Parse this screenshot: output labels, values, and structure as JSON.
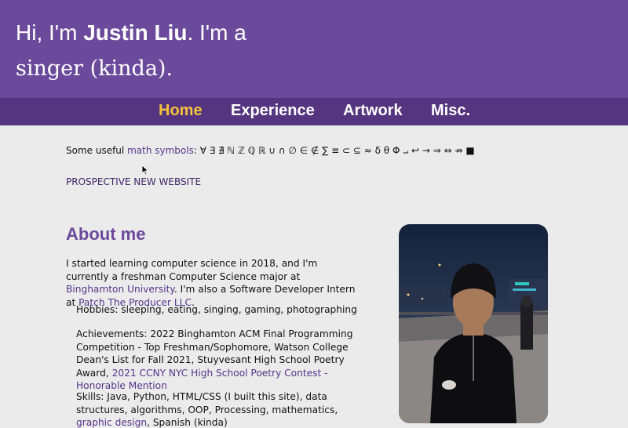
{
  "header": {
    "line1_pre": "Hi, I'm ",
    "line1_name": "Justin Liu",
    "line1_post": ". I'm a",
    "line2": "singer (kinda)."
  },
  "nav": {
    "items": [
      {
        "label": "Home",
        "active": true
      },
      {
        "label": "Experience",
        "active": false
      },
      {
        "label": "Artwork",
        "active": false
      },
      {
        "label": "Misc.",
        "active": false
      }
    ]
  },
  "math": {
    "prefix": "Some useful ",
    "link": "math symbols",
    "suffix": ": ∀ ∃ ∄ ℕ ℤ ℚ ℝ ∪ ∩ ∅ ∈ ∉ ∑ ≡ ⊂ ⊆ ≈ δ θ Φ ⨼ ↩ → ⇒ ⇔ ⇏ ■"
  },
  "prospective": "PROSPECTIVE NEW WEBSITE",
  "about": {
    "title": "About me",
    "intro_a": "I started learning computer science in 2018, and I'm currently a freshman Computer Science major at ",
    "intro_link1": "Binghamton University",
    "intro_b": ". I'm also a Software Developer Intern at ",
    "intro_link2": "Patch The Producer LLC",
    "intro_c": ".",
    "hobbies": "Hobbies: sleeping, eating, singing, gaming, photographing",
    "ach_a": "Achievements: 2022 Binghamton ACM Final Programming Competition - Top Freshman/Sophomore, Watson College Dean's List for Fall 2021, Stuyvesant High School Poetry Award, ",
    "ach_link": "2021 CCNY NYC High School Poetry Contest - Honorable Mention",
    "skills_a": "Skills: Java, Python, HTML/CSS (I built this site), data structures, algorithms, OOP, Processing, mathematics, ",
    "skills_link": "graphic design",
    "skills_b": ", Spanish (kinda)"
  },
  "colors": {
    "header_bg": "#6b4a9c",
    "nav_bg": "#55357f",
    "nav_active": "#f5c23b",
    "link": "#55358c",
    "page_bg": "#ebebeb"
  }
}
